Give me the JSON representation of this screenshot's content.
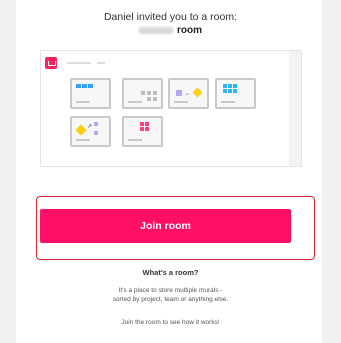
{
  "invite": {
    "message": "Daniel invited you to a room:",
    "room_name": "room"
  },
  "join_button_label": "Join room",
  "info": {
    "title": "What's a room?",
    "description_line1": "It's a place to store multiple murals -",
    "description_line2": "sorted by project, team or anything else.",
    "footer": "Join the room to see how it works!"
  },
  "colors": {
    "brand": "#ff0f66",
    "highlight_border": "#e0242c"
  }
}
